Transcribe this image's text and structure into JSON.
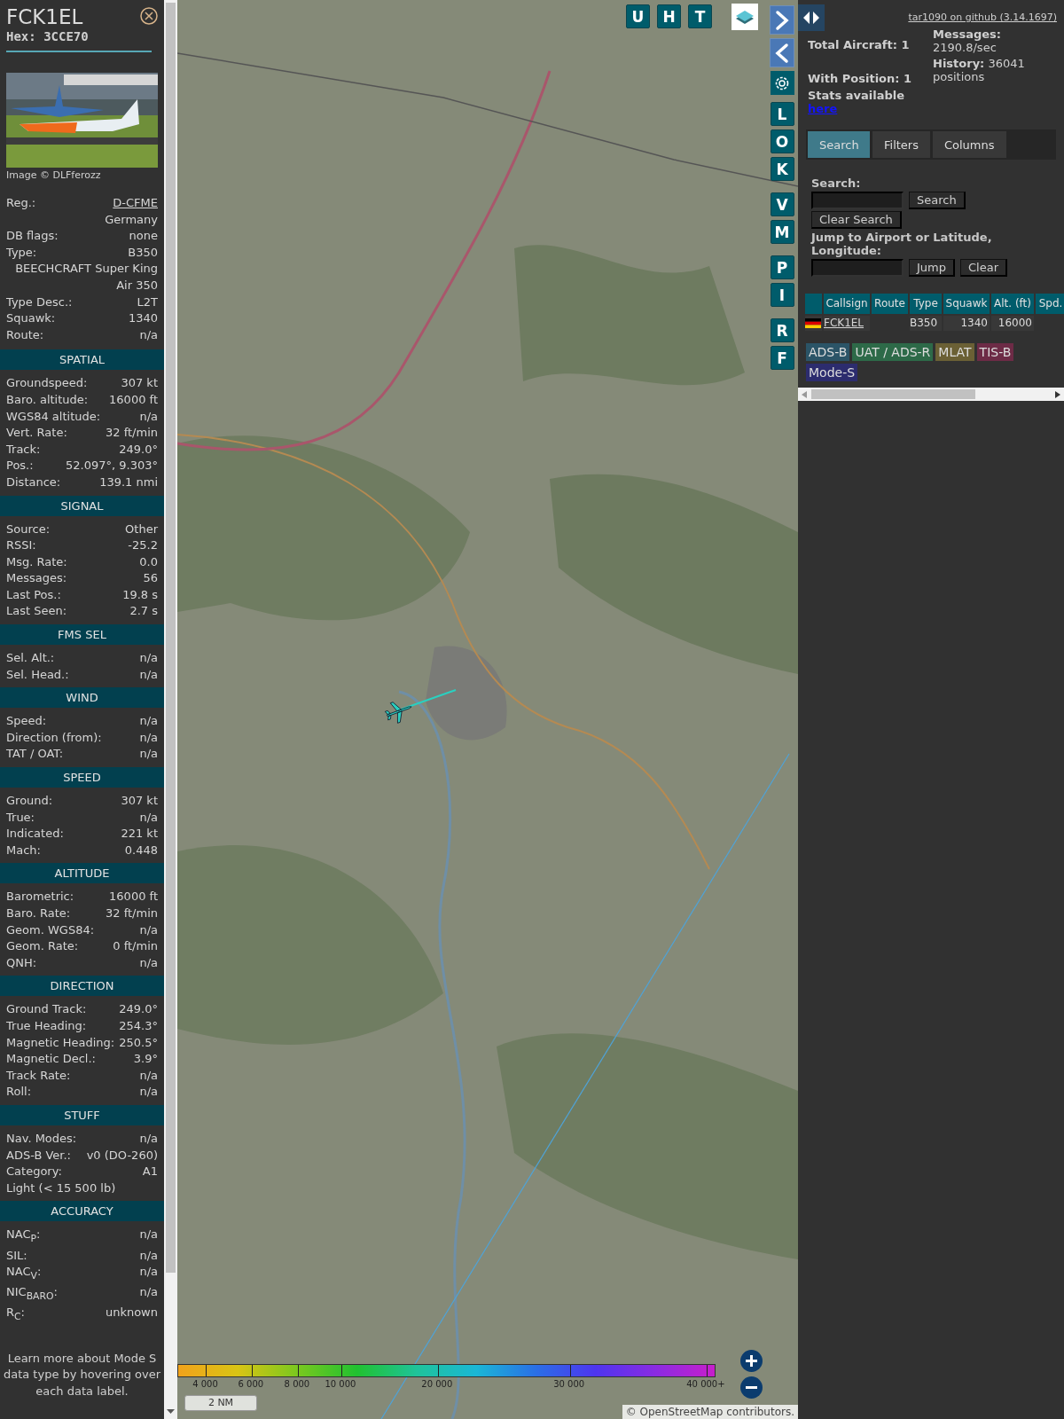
{
  "aircraft": {
    "callsign": "FCK1EL",
    "hex": "Hex: 3CCE70"
  },
  "photo": {
    "kind": "picture",
    "credit": "Image © DLFferozz"
  },
  "info_rows": [
    {
      "kind": "link",
      "label": "Reg.:",
      "value": "D-CFME"
    },
    {
      "kind": "value",
      "value": "Germany"
    },
    {
      "kind": "pair",
      "label": "DB flags:",
      "value": "none"
    },
    {
      "kind": "pair",
      "label": "Type:",
      "value": "B350"
    },
    {
      "kind": "value",
      "value": "BEECHCRAFT Super King Air 350"
    },
    {
      "kind": "pair",
      "label": "Type Desc.:",
      "value": "L2T"
    },
    {
      "kind": "pair",
      "label": "Squawk:",
      "value": "1340"
    },
    {
      "kind": "pair",
      "label": "Route:",
      "value": "n/a"
    }
  ],
  "sections": [
    {
      "title": "SPATIAL",
      "rows": [
        {
          "kind": "pair",
          "label": "Groundspeed:",
          "value": "307 kt"
        },
        {
          "kind": "pair",
          "label": "Baro. altitude:",
          "value": "16000 ft"
        },
        {
          "kind": "pair",
          "label": "WGS84 altitude:",
          "value": "n/a"
        },
        {
          "kind": "pair",
          "label": "Vert. Rate:",
          "value": "32 ft/min"
        },
        {
          "kind": "pair",
          "label": "Track:",
          "value": "249.0°"
        },
        {
          "kind": "pair",
          "label": "Pos.:",
          "value": "52.097°, 9.303°"
        },
        {
          "kind": "pair",
          "label": "Distance:",
          "value": "139.1 nmi"
        }
      ]
    },
    {
      "title": "SIGNAL",
      "rows": [
        {
          "kind": "pair",
          "label": "Source:",
          "value": "Other"
        },
        {
          "kind": "pair",
          "label": "RSSI:",
          "value": "-25.2"
        },
        {
          "kind": "pair",
          "label": "Msg. Rate:",
          "value": "0.0"
        },
        {
          "kind": "pair",
          "label": "Messages:",
          "value": "56"
        },
        {
          "kind": "pair",
          "label": "Last Pos.:",
          "value": "19.8 s"
        },
        {
          "kind": "pair",
          "label": "Last Seen:",
          "value": "2.7 s"
        }
      ]
    },
    {
      "title": "FMS SEL",
      "rows": [
        {
          "kind": "pair",
          "label": "Sel. Alt.:",
          "value": "n/a"
        },
        {
          "kind": "pair",
          "label": "Sel. Head.:",
          "value": "n/a"
        }
      ]
    },
    {
      "title": "WIND",
      "rows": [
        {
          "kind": "pair",
          "label": "Speed:",
          "value": "n/a"
        },
        {
          "kind": "pair",
          "label": "Direction (from):",
          "value": "n/a"
        },
        {
          "kind": "pair",
          "label": "TAT / OAT:",
          "value": "n/a"
        }
      ]
    },
    {
      "title": "SPEED",
      "rows": [
        {
          "kind": "pair",
          "label": "Ground:",
          "value": "307 kt"
        },
        {
          "kind": "pair",
          "label": "True:",
          "value": "n/a"
        },
        {
          "kind": "pair",
          "label": "Indicated:",
          "value": "221 kt"
        },
        {
          "kind": "pair",
          "label": "Mach:",
          "value": "0.448"
        }
      ]
    },
    {
      "title": "ALTITUDE",
      "rows": [
        {
          "kind": "pair",
          "label": "Barometric:",
          "value": "16000 ft"
        },
        {
          "kind": "pair",
          "label": "Baro. Rate:",
          "value": "32 ft/min"
        },
        {
          "kind": "pair",
          "label": "Geom. WGS84:",
          "value": "n/a"
        },
        {
          "kind": "pair",
          "label": "Geom. Rate:",
          "value": "0 ft/min"
        },
        {
          "kind": "pair",
          "label": "QNH:",
          "value": "n/a"
        }
      ]
    },
    {
      "title": "DIRECTION",
      "rows": [
        {
          "kind": "pair",
          "label": "Ground Track:",
          "value": "249.0°"
        },
        {
          "kind": "pair",
          "label": "True Heading:",
          "value": "254.3°"
        },
        {
          "kind": "pair",
          "label": "Magnetic Heading:",
          "value": "250.5°"
        },
        {
          "kind": "pair",
          "label": "Magnetic Decl.:",
          "value": "3.9°"
        },
        {
          "kind": "pair",
          "label": "Track Rate:",
          "value": "n/a"
        },
        {
          "kind": "pair",
          "label": "Roll:",
          "value": "n/a"
        }
      ]
    },
    {
      "title": "STUFF",
      "rows": [
        {
          "kind": "pair",
          "label": "Nav. Modes:",
          "value": "n/a"
        },
        {
          "kind": "pair",
          "label": "ADS-B Ver.:",
          "value": "v0 (DO-260)"
        },
        {
          "kind": "pair",
          "label": "Category:",
          "value": "A1"
        },
        {
          "kind": "note",
          "value": "Light (< 15 500 lb)"
        }
      ]
    },
    {
      "title": "ACCURACY",
      "rows": [
        {
          "kind": "pair",
          "label": "NAC$_{P}$:",
          "value": "n/a"
        },
        {
          "kind": "pair",
          "label": "SIL:",
          "value": "n/a"
        },
        {
          "kind": "pair",
          "label": "NAC$_{V}$:",
          "value": "n/a"
        },
        {
          "kind": "pair",
          "label": "NIC$_{BARO}$:",
          "value": "n/a"
        },
        {
          "kind": "pair",
          "label": "R$_{C}$:",
          "value": "unknown"
        }
      ]
    }
  ],
  "footer_note": "Learn more about Mode S data type by hovering over each data label.",
  "map": {
    "kind": "picture",
    "top_buttons": [
      "U",
      "H",
      "T"
    ],
    "side_button_groups": [
      [
        "L",
        "O",
        "K"
      ],
      [
        "V",
        "M"
      ],
      [
        "P",
        "I"
      ],
      [
        "R",
        "F"
      ]
    ],
    "altitude_legend": [
      "4 000",
      "6 000",
      "8 000",
      "10 000",
      "20 000",
      "30 000",
      "40 000+"
    ],
    "scale": "2 NM",
    "attribution_prefix": "©",
    "attribution_link": "OpenStreetMap",
    "attribution_suffix": "contributors."
  },
  "right_panel": {
    "version_link": "tar1090 on github (3.14.1697)",
    "stats": [
      {
        "label": "Total Aircraft:",
        "value": "1"
      },
      {
        "label": "With Position:",
        "value": "1"
      }
    ],
    "messages": {
      "label": "Messages:",
      "value": "2190.8/sec"
    },
    "history": {
      "label": "History:",
      "value": "36041 positions"
    },
    "stats_link": {
      "label": "Stats available",
      "link": "here"
    },
    "tabs": [
      {
        "label": "Search",
        "selected": true
      },
      {
        "label": "Filters",
        "selected": false
      },
      {
        "label": "Columns",
        "selected": false
      }
    ],
    "search": {
      "label": "Search:",
      "button": "Search",
      "clear_button": "Clear Search"
    },
    "jump": {
      "label": "Jump to Airport or Latitude, Longitude:",
      "button": "Jump",
      "clear_button": "Clear"
    },
    "table": {
      "columns": [
        "Callsign",
        "Route",
        "Type",
        "Squawk",
        "Alt. (ft)",
        "Spd."
      ],
      "rows": [
        {
          "callsign": "FCK1EL",
          "type": "B350",
          "squawk": "1340",
          "altitude": "16000"
        }
      ]
    },
    "source_tags": [
      {
        "label": "ADS-B",
        "color": "#2b5467"
      },
      {
        "label": "UAT / ADS-R",
        "color": "#2d6a48"
      },
      {
        "label": "MLAT",
        "color": "#6b6035"
      },
      {
        "label": "TIS-B",
        "color": "#6d2b46"
      },
      {
        "label": "Mode-S",
        "color": "#2c2c6e"
      }
    ]
  }
}
